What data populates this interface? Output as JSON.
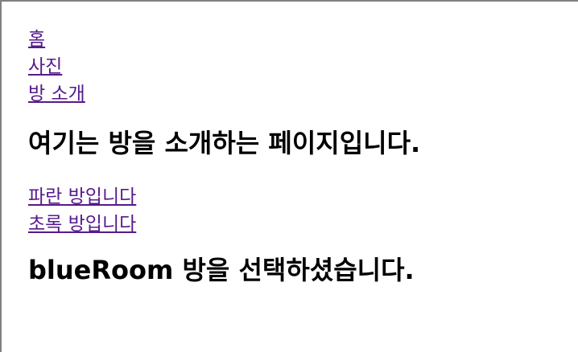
{
  "nav": {
    "items": [
      {
        "label": "홈"
      },
      {
        "label": "사진"
      },
      {
        "label": "방 소개"
      }
    ]
  },
  "page": {
    "heading": "여기는 방을 소개하는 페이지입니다."
  },
  "rooms": {
    "links": [
      {
        "label": "파란 방입니다"
      },
      {
        "label": "초록 방입니다"
      }
    ]
  },
  "selection": {
    "message": "blueRoom 방을 선택하셨습니다."
  },
  "colors": {
    "link": "#551a8b",
    "text": "#000000",
    "background": "#ffffff",
    "frame_border": "#808080"
  }
}
